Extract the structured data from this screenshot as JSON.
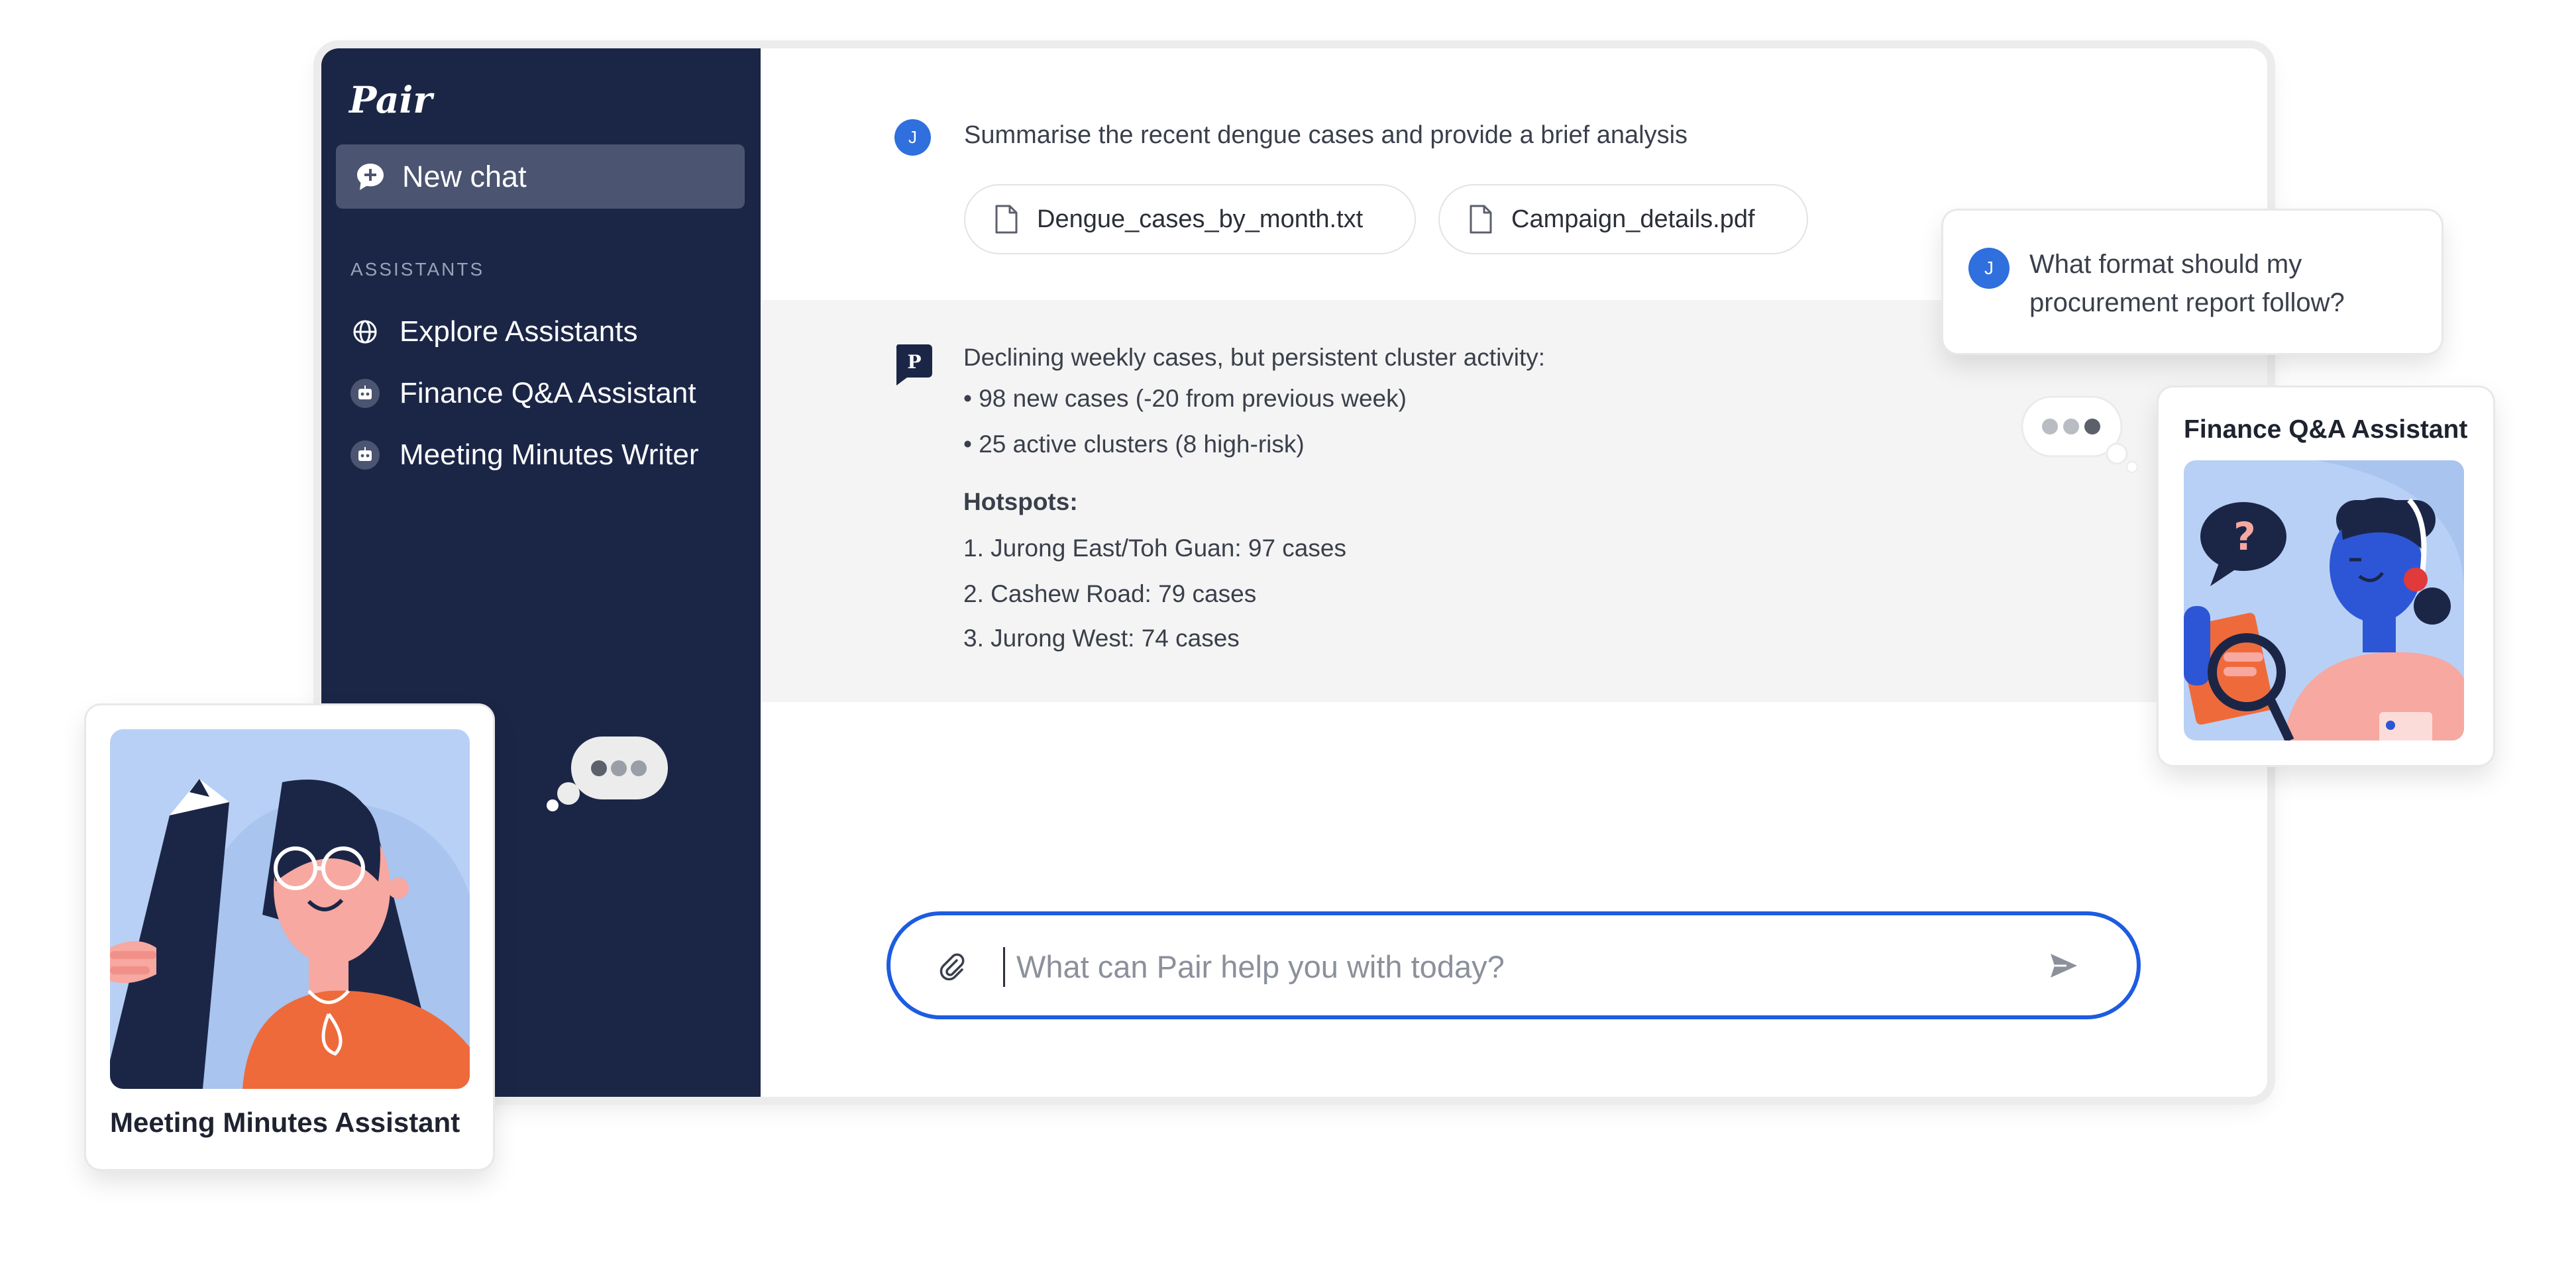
{
  "app": {
    "name": "Pair"
  },
  "sidebar": {
    "new_chat_label": "New chat",
    "assistants_heading": "ASSISTANTS",
    "items": [
      {
        "label": "Explore Assistants",
        "icon": "globe-icon"
      },
      {
        "label": "Finance Q&A Assistant",
        "icon": "robot-icon"
      },
      {
        "label": "Meeting Minutes Writer",
        "icon": "robot-icon"
      }
    ]
  },
  "chat": {
    "user_initial": "J",
    "user_message": "Summarise the recent dengue cases and provide a brief analysis",
    "attachments": [
      {
        "name": "Dengue_cases_by_month.txt",
        "icon": "file-icon"
      },
      {
        "name": "Campaign_details.pdf",
        "icon": "file-icon"
      }
    ],
    "bot_initial": "P",
    "response": {
      "intro": "Declining weekly cases, but persistent cluster activity:",
      "bullets": [
        "• 98 new cases (-20 from previous week)",
        "• 25 active clusters (8 high-risk)"
      ],
      "hotspots_title": "Hotspots:",
      "hotspots": [
        "1. Jurong East/Toh Guan: 97 cases",
        "2. Cashew Road: 79 cases",
        "3. Jurong West: 74 cases"
      ]
    },
    "composer": {
      "placeholder": "What can Pair help you with today?"
    }
  },
  "floating": {
    "question": {
      "initial": "J",
      "text": "What format should my procurement report follow?"
    },
    "finance_card_title": "Finance Q&A Assistant",
    "minutes_card_title": "Meeting Minutes Assistant"
  },
  "colors": {
    "sidebar_bg": "#1b2647",
    "accent": "#1d5ce0",
    "avatar_blue": "#2f6fde",
    "response_bg": "#f4f4f4"
  }
}
